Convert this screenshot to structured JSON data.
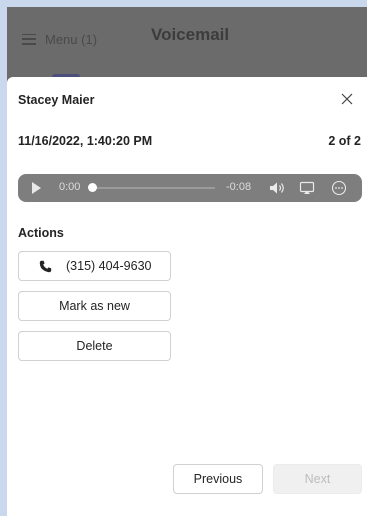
{
  "background_app": {
    "menu_label": "Menu (1)",
    "title": "Voicemail"
  },
  "panel": {
    "caller_name": "Stacey Maier",
    "datetime": "11/16/2022, 1:40:20 PM",
    "position": "2 of 2",
    "player": {
      "current_time": "0:00",
      "remaining_time": "-0:08",
      "progress": 0
    },
    "actions_label": "Actions",
    "actions": {
      "call_number": "(315) 404-9630",
      "mark_as_new": "Mark as new",
      "delete": "Delete"
    },
    "nav": {
      "previous": "Previous",
      "next": "Next"
    }
  },
  "icons": {
    "menu": "hamburger-icon",
    "close": "close-icon",
    "play": "play-icon",
    "volume": "volume-icon",
    "cast": "cast-icon",
    "more": "more-options-icon",
    "phone": "phone-icon"
  },
  "colors": {
    "page_bg": "#c9d8ec",
    "overlay": "#6b6b6b",
    "panel_bg": "#ffffff",
    "player_bg": "#7e7e7e",
    "disabled_text": "#bdbdbd"
  }
}
